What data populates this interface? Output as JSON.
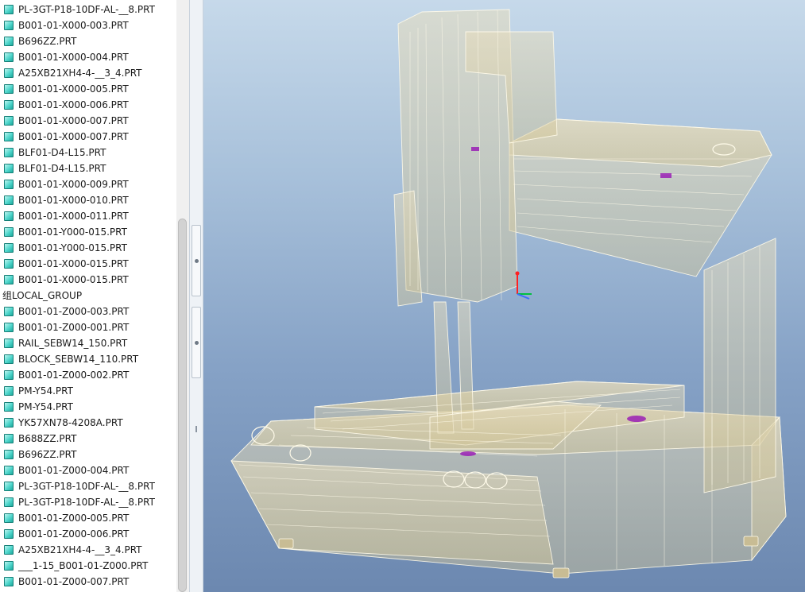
{
  "model_tree": {
    "items": [
      {
        "label": "PL-3GT-P18-10DF-AL-__8.PRT",
        "type": "part"
      },
      {
        "label": "B001-01-X000-003.PRT",
        "type": "part"
      },
      {
        "label": "B696ZZ.PRT",
        "type": "part"
      },
      {
        "label": "B001-01-X000-004.PRT",
        "type": "part"
      },
      {
        "label": "A25XB21XH4-4-__3_4.PRT",
        "type": "part"
      },
      {
        "label": "B001-01-X000-005.PRT",
        "type": "part"
      },
      {
        "label": "B001-01-X000-006.PRT",
        "type": "part"
      },
      {
        "label": "B001-01-X000-007.PRT",
        "type": "part"
      },
      {
        "label": "B001-01-X000-007.PRT",
        "type": "part"
      },
      {
        "label": "BLF01-D4-L15.PRT",
        "type": "part"
      },
      {
        "label": "BLF01-D4-L15.PRT",
        "type": "part"
      },
      {
        "label": "B001-01-X000-009.PRT",
        "type": "part"
      },
      {
        "label": "B001-01-X000-010.PRT",
        "type": "part"
      },
      {
        "label": "B001-01-X000-011.PRT",
        "type": "part"
      },
      {
        "label": "B001-01-Y000-015.PRT",
        "type": "part"
      },
      {
        "label": "B001-01-Y000-015.PRT",
        "type": "part"
      },
      {
        "label": "B001-01-X000-015.PRT",
        "type": "part"
      },
      {
        "label": "B001-01-X000-015.PRT",
        "type": "part"
      },
      {
        "label": "组LOCAL_GROUP",
        "type": "group"
      },
      {
        "label": "B001-01-Z000-003.PRT",
        "type": "part"
      },
      {
        "label": "B001-01-Z000-001.PRT",
        "type": "part"
      },
      {
        "label": "RAIL_SEBW14_150.PRT",
        "type": "part"
      },
      {
        "label": "BLOCK_SEBW14_110.PRT",
        "type": "part"
      },
      {
        "label": "B001-01-Z000-002.PRT",
        "type": "part"
      },
      {
        "label": "PM-Y54.PRT",
        "type": "part"
      },
      {
        "label": "PM-Y54.PRT",
        "type": "part"
      },
      {
        "label": "YK57XN78-4208A.PRT",
        "type": "part"
      },
      {
        "label": "B688ZZ.PRT",
        "type": "part"
      },
      {
        "label": "B696ZZ.PRT",
        "type": "part"
      },
      {
        "label": "B001-01-Z000-004.PRT",
        "type": "part"
      },
      {
        "label": "PL-3GT-P18-10DF-AL-__8.PRT",
        "type": "part"
      },
      {
        "label": "PL-3GT-P18-10DF-AL-__8.PRT",
        "type": "part"
      },
      {
        "label": "B001-01-Z000-005.PRT",
        "type": "part"
      },
      {
        "label": "B001-01-Z000-006.PRT",
        "type": "part"
      },
      {
        "label": "A25XB21XH4-4-__3_4.PRT",
        "type": "part"
      },
      {
        "label": "___1-15_B001-01-Z000.PRT",
        "type": "part"
      },
      {
        "label": "B001-01-Z000-007.PRT",
        "type": "part"
      }
    ],
    "part_icon": "part-icon"
  },
  "viewport": {
    "display_style": "transparent wireframe",
    "colors": {
      "background_top": "#c6d9ea",
      "background_bottom": "#6c88b0",
      "model_fill": "#dfd3ae",
      "model_edge": "#fffbea",
      "axis_x": "#3b6cff",
      "axis_y": "#00c040",
      "axis_z": "#ff2020",
      "highlight": "#9a1fb5"
    }
  }
}
